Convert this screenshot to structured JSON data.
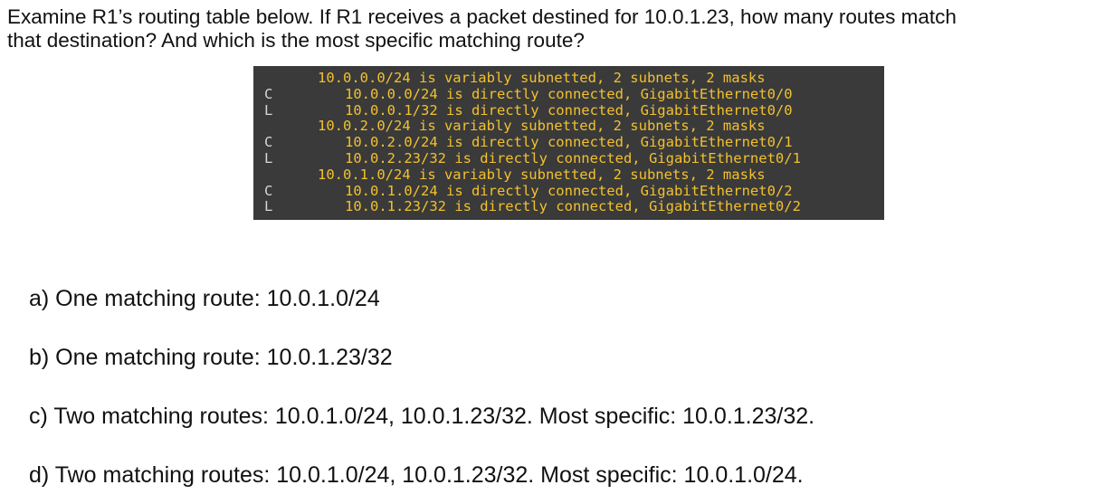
{
  "question": {
    "line1": "Examine R1’s routing table below. If R1 receives a packet destined for 10.0.1.23, how many routes match",
    "line2": "that destination? And which is the most specific matching route?"
  },
  "routing_table": [
    {
      "code": "",
      "text": "10.0.0.0/24 is variably subnetted, 2 subnets, 2 masks"
    },
    {
      "code": "C",
      "text": "10.0.0.0/24 is directly connected, GigabitEthernet0/0"
    },
    {
      "code": "L",
      "text": "10.0.0.1/32 is directly connected, GigabitEthernet0/0"
    },
    {
      "code": "",
      "text": "10.0.2.0/24 is variably subnetted, 2 subnets, 2 masks"
    },
    {
      "code": "C",
      "text": "10.0.2.0/24 is directly connected, GigabitEthernet0/1"
    },
    {
      "code": "L",
      "text": "10.0.2.23/32 is directly connected, GigabitEthernet0/1"
    },
    {
      "code": "",
      "text": "10.0.1.0/24 is variably subnetted, 2 subnets, 2 masks"
    },
    {
      "code": "C",
      "text": "10.0.1.0/24 is directly connected, GigabitEthernet0/2"
    },
    {
      "code": "L",
      "text": "10.0.1.23/32 is directly connected, GigabitEthernet0/2"
    }
  ],
  "options": {
    "a": "a) One matching route: 10.0.1.0/24",
    "b": "b) One matching route: 10.0.1.23/32",
    "c": "c) Two matching routes: 10.0.1.0/24, 10.0.1.23/32. Most specific: 10.0.1.23/32.",
    "d": "d) Two matching routes: 10.0.1.0/24, 10.0.1.23/32. Most specific: 10.0.1.0/24."
  }
}
